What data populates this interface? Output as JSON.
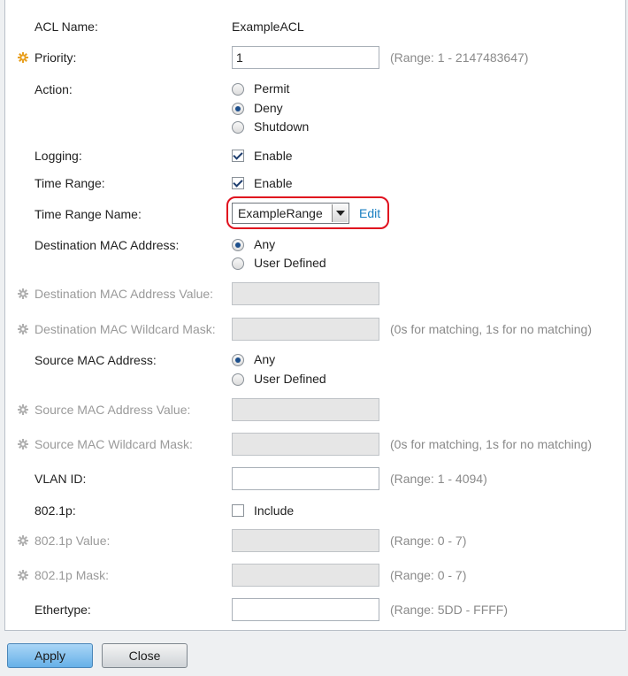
{
  "form": {
    "acl_name": {
      "label": "ACL Name:",
      "value": "ExampleACL"
    },
    "priority": {
      "label": "Priority:",
      "value": "1",
      "hint": "(Range: 1 - 2147483647)"
    },
    "action": {
      "label": "Action:",
      "options": [
        "Permit",
        "Deny",
        "Shutdown"
      ],
      "selected": "Deny"
    },
    "logging": {
      "label": "Logging:",
      "checkbox_label": "Enable",
      "checked": true
    },
    "time_range": {
      "label": "Time Range:",
      "checkbox_label": "Enable",
      "checked": true
    },
    "time_range_name": {
      "label": "Time Range Name:",
      "selected": "ExampleRange",
      "edit_link": "Edit"
    },
    "dest_mac": {
      "label": "Destination MAC Address:",
      "options": [
        "Any",
        "User Defined"
      ],
      "selected": "Any"
    },
    "dest_mac_value": {
      "label": "Destination MAC Address Value:",
      "value": ""
    },
    "dest_mac_mask": {
      "label": "Destination MAC Wildcard Mask:",
      "value": "",
      "hint": "(0s for matching, 1s for no matching)"
    },
    "src_mac": {
      "label": "Source MAC Address:",
      "options": [
        "Any",
        "User Defined"
      ],
      "selected": "Any"
    },
    "src_mac_value": {
      "label": "Source MAC Address Value:",
      "value": ""
    },
    "src_mac_mask": {
      "label": "Source MAC Wildcard Mask:",
      "value": "",
      "hint": "(0s for matching, 1s for no matching)"
    },
    "vlan_id": {
      "label": "VLAN ID:",
      "value": "",
      "hint": "(Range: 1 - 4094)"
    },
    "dot1p": {
      "label": "802.1p:",
      "checkbox_label": "Include",
      "checked": false
    },
    "dot1p_value": {
      "label": "802.1p Value:",
      "value": "",
      "hint": "(Range: 0 - 7)"
    },
    "dot1p_mask": {
      "label": "802.1p Mask:",
      "value": "",
      "hint": "(Range: 0 - 7)"
    },
    "ethertype": {
      "label": "Ethertype:",
      "value": "",
      "hint": "(Range: 5DD - FFFF)"
    }
  },
  "buttons": {
    "apply": "Apply",
    "close": "Close"
  },
  "colors": {
    "highlight": "#e0101e",
    "link": "#1a7fc1",
    "required_icon": "#e8a020",
    "disabled_icon": "#b0b0b0"
  }
}
